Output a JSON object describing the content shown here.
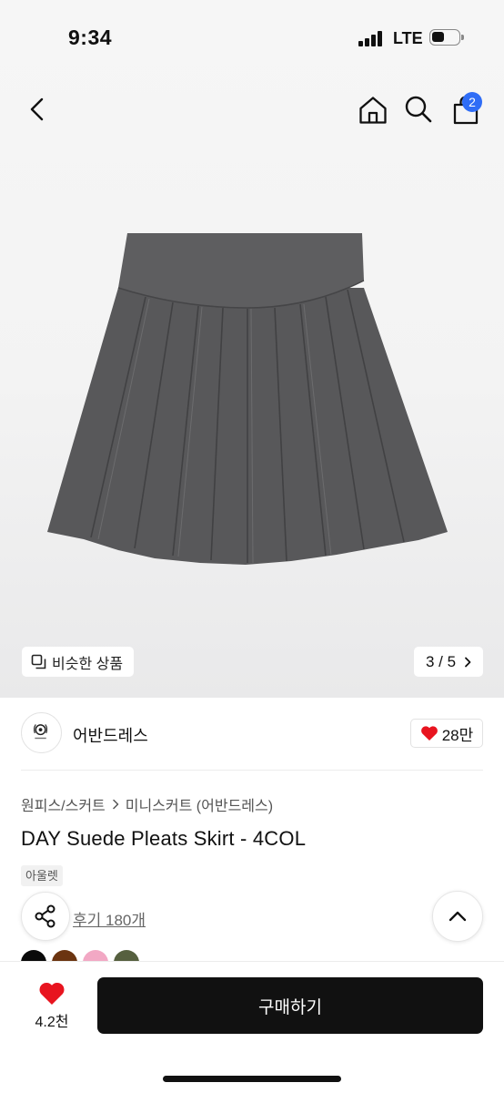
{
  "status_bar": {
    "time": "9:34",
    "network": "LTE"
  },
  "header": {
    "back_icon": "chevron-left-icon",
    "home_icon": "home-icon",
    "search_icon": "search-icon",
    "cart_icon": "shopping-bag-icon",
    "cart_badge": "2",
    "badge_color": "#2f6df6"
  },
  "gallery": {
    "similar_label": "비슷한 상품",
    "similar_icon": "copy-icon",
    "counter": "3 / 5",
    "counter_icon": "chevron-right-icon"
  },
  "shop": {
    "name": "어반드레스",
    "logo_icon": "shop-logo-icon",
    "like_count": "28만",
    "like_icon": "heart-icon",
    "heart_color": "#e8141f"
  },
  "product": {
    "breadcrumb": [
      "원피스/스커트",
      "미니스커트 (어반드레스)"
    ],
    "title": "DAY Suede Pleats Skirt - 4COL",
    "tag": "아울렛",
    "review_link": "후기 180개",
    "swatches": [
      "#0a0a0a",
      "#6b3410",
      "#f2a8c4",
      "#56603f"
    ]
  },
  "bottom_bar": {
    "wish_count": "4.2천",
    "buy_label": "구매하기"
  }
}
